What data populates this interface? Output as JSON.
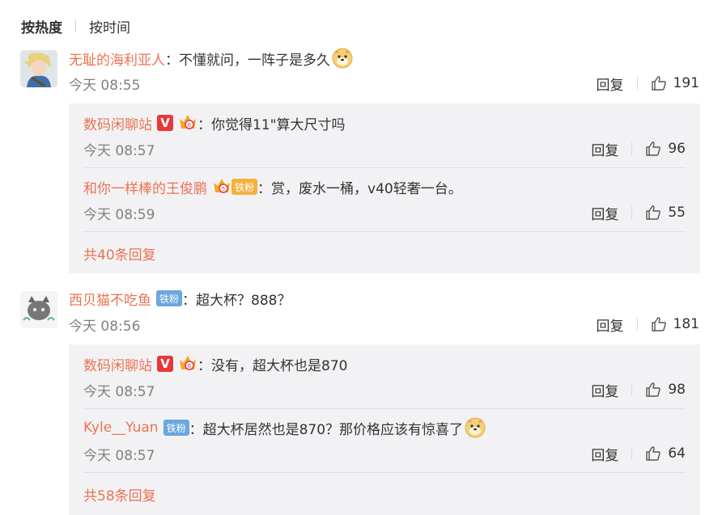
{
  "tabs": {
    "hot": "按热度",
    "time": "按时间"
  },
  "comments": [
    {
      "name": "无耻的海利亚人",
      "text": "：不懂就问，一阵子是多久",
      "time": "今天 08:55",
      "reply": "回复",
      "likes": "191",
      "replies": [
        {
          "name": "数码闲聊站",
          "text": "：你觉得11\"算大尺寸吗",
          "time": "今天 08:57",
          "reply": "回复",
          "likes": "96"
        },
        {
          "name": "和你一样棒的王俊鹏",
          "fan_badge": "铁粉",
          "text": "：赏，废水一桶，v40轻奢一台。",
          "time": "今天 08:59",
          "reply": "回复",
          "likes": "55"
        }
      ],
      "more": "共40条回复"
    },
    {
      "name": "西贝猫不吃鱼",
      "fan_badge": "铁粉",
      "text": "：超大杯？888？",
      "time": "今天 08:56",
      "reply": "回复",
      "likes": "181",
      "replies": [
        {
          "name": "数码闲聊站",
          "text": "：没有，超大杯也是870",
          "time": "今天 08:57",
          "reply": "回复",
          "likes": "98"
        },
        {
          "name": "Kyle__Yuan",
          "fan_badge": "铁粉",
          "text": "：超大杯居然也是870？那价格应该有惊喜了",
          "time": "今天 08:57",
          "reply": "回复",
          "likes": "64"
        }
      ],
      "more": "共58条回复"
    }
  ],
  "badges": {
    "vip_letter": "V"
  },
  "colors": {
    "name": "#eb7350",
    "sub_bg": "#f2f2f5",
    "meta": "#808080",
    "v_badge": "#e8383b",
    "fan_badge": "#6aa7e0"
  },
  "icons": [
    "like-icon",
    "doge-emoji-icon",
    "crown-icon",
    "avatar-elf",
    "avatar-cat"
  ]
}
